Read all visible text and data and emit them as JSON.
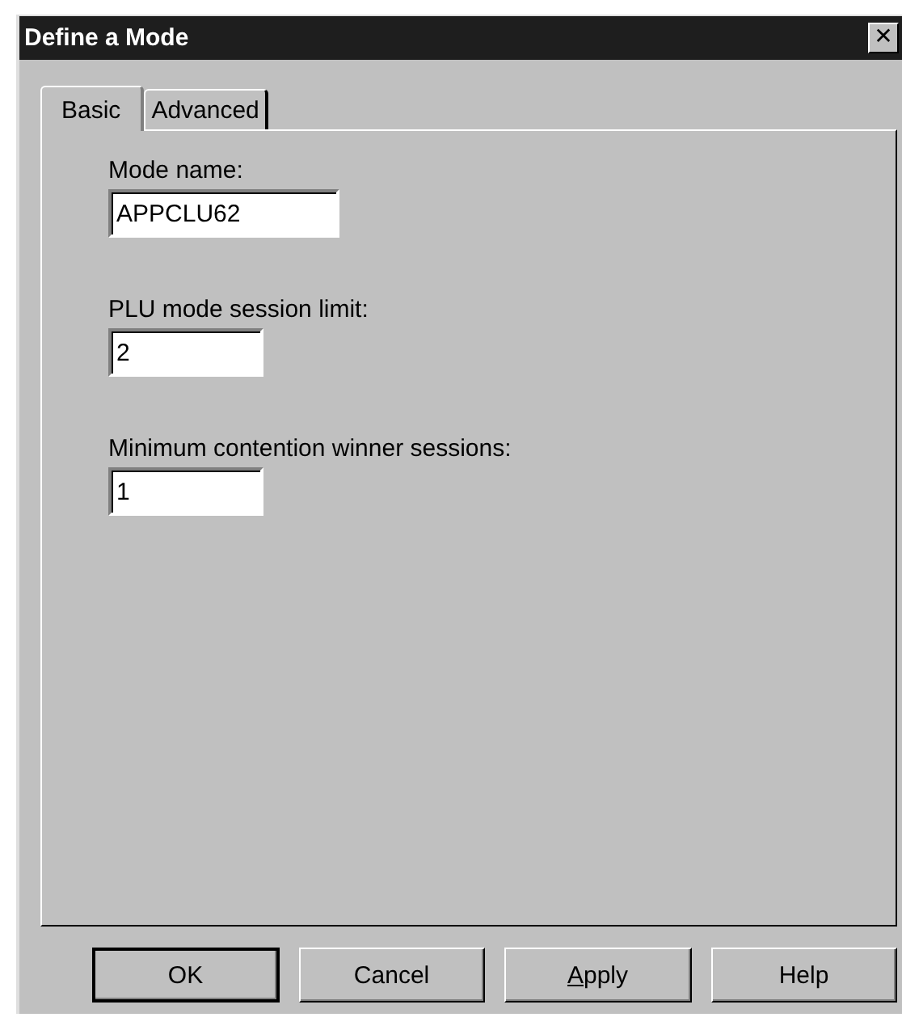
{
  "window": {
    "title": "Define a Mode",
    "close": "✕"
  },
  "tabs": [
    {
      "label": "Basic",
      "selected": true
    },
    {
      "label": "Advanced",
      "selected": false
    }
  ],
  "fields": [
    {
      "label": "Mode name:",
      "value": "APPCLU62",
      "wide": true
    },
    {
      "label": "PLU mode session limit:",
      "value": "2",
      "wide": false
    },
    {
      "label": "Minimum contention winner sessions:",
      "value": "1",
      "wide": false
    }
  ],
  "buttons": [
    {
      "label": "OK",
      "default": true,
      "mnemonic": false
    },
    {
      "label": "Cancel",
      "default": false,
      "mnemonic": false
    },
    {
      "label": "Apply",
      "default": false,
      "mnemonic": true
    },
    {
      "label": "Help",
      "default": false,
      "mnemonic": false
    }
  ]
}
